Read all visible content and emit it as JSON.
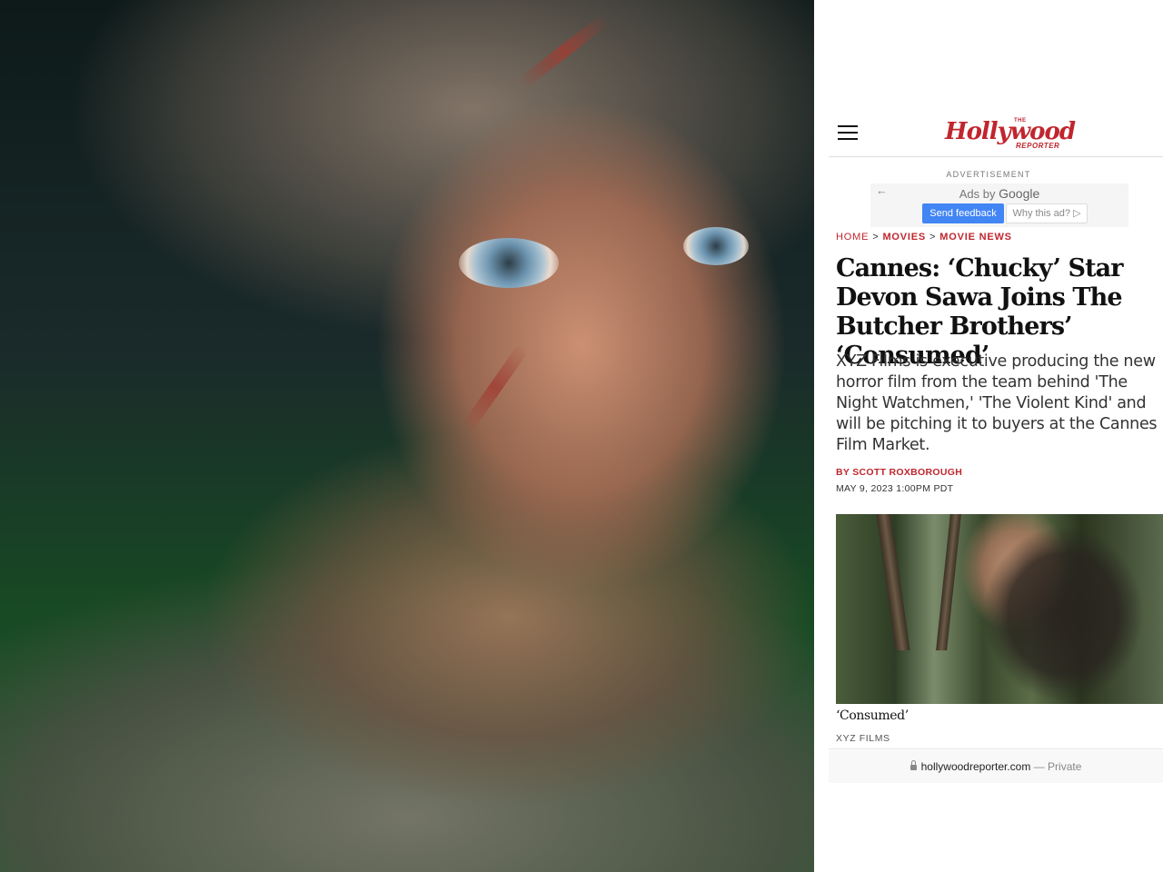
{
  "site": {
    "logo_small": "THE",
    "logo_main": "Hollywood",
    "logo_sub": "REPORTER",
    "brand_color": "#c0262e"
  },
  "ad": {
    "label": "ADVERTISEMENT",
    "ads_by_prefix": "Ads by",
    "ads_by_brand": "Google",
    "back_icon": "←",
    "feedback_label": "Send feedback",
    "why_label": "Why this ad? ▷",
    "feedback_color": "#4285f4"
  },
  "breadcrumb": {
    "home": "HOME",
    "movies": "MOVIES",
    "movie_news": "MOVIE NEWS",
    "separator": ">"
  },
  "article": {
    "headline": "Cannes: ‘Chucky’ Star Devon Sawa Joins The Butcher Brothers’ ‘Consumed’",
    "dek": "XYZ Films is executive producing the new horror film from the team behind 'The Night Watchmen,' 'The Violent Kind' and will be pitching it to buyers at the Cannes Film Market.",
    "byline_prefix": "BY",
    "author": "SCOTT ROXBOROUGH",
    "date": "MAY 9, 2023 1:00PM PDT",
    "image_caption": "‘Consumed’",
    "image_credit": "XYZ FILMS"
  },
  "browser": {
    "url": "hollywoodreporter.com",
    "privacy": "— Private",
    "icons": [
      "lock-icon",
      "menu-icon"
    ]
  }
}
